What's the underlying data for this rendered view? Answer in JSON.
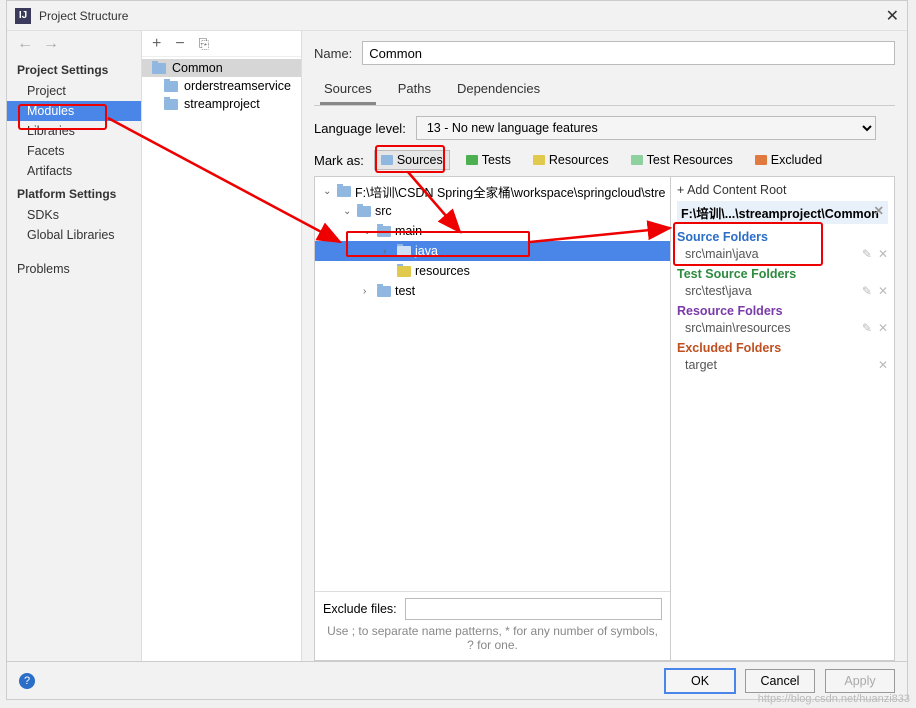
{
  "window": {
    "title": "Project Structure"
  },
  "nav": {
    "header1": "Project Settings",
    "items1": [
      "Project",
      "Modules",
      "Libraries",
      "Facets",
      "Artifacts"
    ],
    "header2": "Platform Settings",
    "items2": [
      "SDKs",
      "Global Libraries"
    ],
    "problems": "Problems"
  },
  "modules": {
    "selected": "Common",
    "items": [
      "Common",
      "orderstreamservice",
      "streamproject"
    ]
  },
  "detail": {
    "name_label": "Name:",
    "name_value": "Common",
    "tabs": [
      "Sources",
      "Paths",
      "Dependencies"
    ],
    "lang_label": "Language level:",
    "lang_value": "13 - No new language features",
    "mark_label": "Mark as:",
    "mark_buttons": {
      "sources": "Sources",
      "tests": "Tests",
      "resources": "Resources",
      "test_resources": "Test Resources",
      "excluded": "Excluded"
    }
  },
  "tree": {
    "root": "F:\\培训\\CSDN Spring全家桶\\workspace\\springcloud\\stre",
    "src": "src",
    "main": "main",
    "java": "java",
    "resources": "resources",
    "test": "test"
  },
  "exclude": {
    "label": "Exclude files:",
    "hint": "Use ; to separate name patterns, * for any number of symbols, ? for one."
  },
  "roots": {
    "add": "+ Add Content Root",
    "path": "F:\\培训\\...\\streamproject\\Common",
    "source_hdr": "Source Folders",
    "source_item": "src\\main\\java",
    "test_hdr": "Test Source Folders",
    "test_item": "src\\test\\java",
    "res_hdr": "Resource Folders",
    "res_item": "src\\main\\resources",
    "exc_hdr": "Excluded Folders",
    "exc_item": "target"
  },
  "footer": {
    "ok": "OK",
    "cancel": "Cancel",
    "apply": "Apply"
  },
  "watermark": "https://blog.csdn.net/huanzi833"
}
